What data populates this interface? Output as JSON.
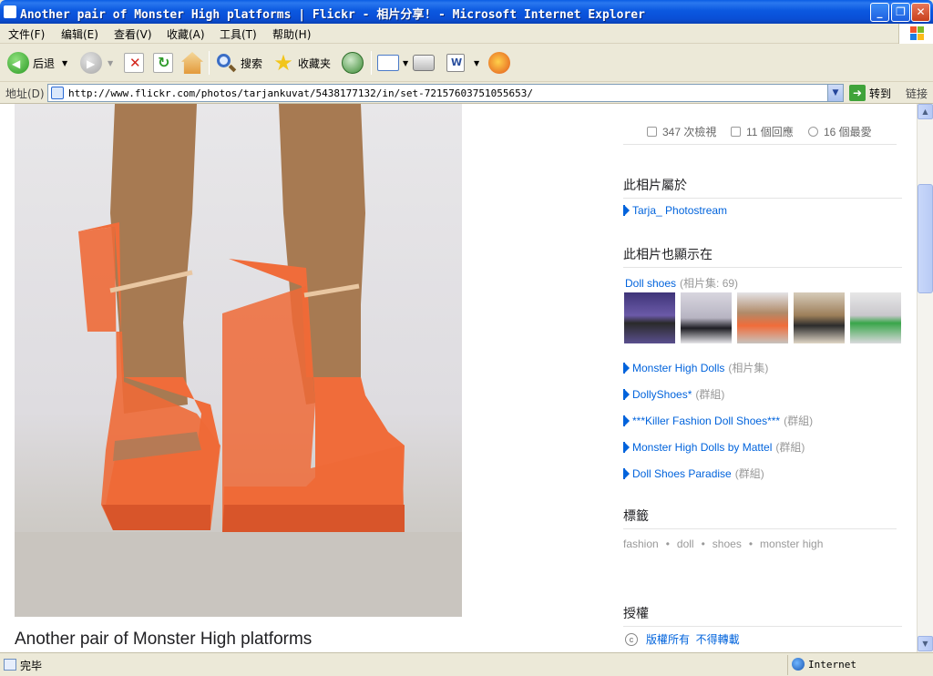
{
  "window": {
    "title": "Another pair of Monster High platforms | Flickr - 相片分享! - Microsoft Internet Explorer",
    "controls": {
      "minimize": "_",
      "maximize": "❐",
      "close": "✕"
    }
  },
  "menu": [
    {
      "label": "文件(F)"
    },
    {
      "label": "编辑(E)"
    },
    {
      "label": "查看(V)"
    },
    {
      "label": "收藏(A)"
    },
    {
      "label": "工具(T)"
    },
    {
      "label": "帮助(H)"
    }
  ],
  "toolbar": {
    "back": "后退",
    "search": "搜索",
    "favorites": "收藏夹"
  },
  "address": {
    "label": "地址(D)",
    "url": "http://www.flickr.com/photos/tarjankuvat/5438177132/in/set-72157603751055653/",
    "go": "转到",
    "links": "链接"
  },
  "photo": {
    "caption": "Another pair of Monster High platforms"
  },
  "stats": {
    "views": "347 次檢視",
    "comments": "11 個回應",
    "faves": "16 個最愛"
  },
  "belongs": {
    "title": "此相片屬於",
    "photostream": "Tarja_ Photostream"
  },
  "appears": {
    "title": "此相片也顯示在",
    "set_name": "Doll shoes",
    "set_meta": "(相片集: 69)",
    "items": [
      {
        "name": "Monster High Dolls",
        "meta": "(相片集)"
      },
      {
        "name": "DollyShoes*",
        "meta": "(群組)"
      },
      {
        "name": "***Killer Fashion Doll Shoes***",
        "meta": "(群組)"
      },
      {
        "name": "Monster High Dolls by Mattel",
        "meta": "(群組)"
      },
      {
        "name": "Doll Shoes Paradise",
        "meta": "(群組)"
      }
    ]
  },
  "tags": {
    "title": "標籤",
    "items": [
      "fashion",
      "doll",
      "shoes",
      "monster high"
    ]
  },
  "license": {
    "title": "授權",
    "text": "版權所有  不得轉載"
  },
  "status": {
    "text": "完毕",
    "zone": "Internet"
  },
  "colors": {
    "link": "#0063dc",
    "shoe": "#f06c3a",
    "titlebar": "#0a5ce4"
  }
}
